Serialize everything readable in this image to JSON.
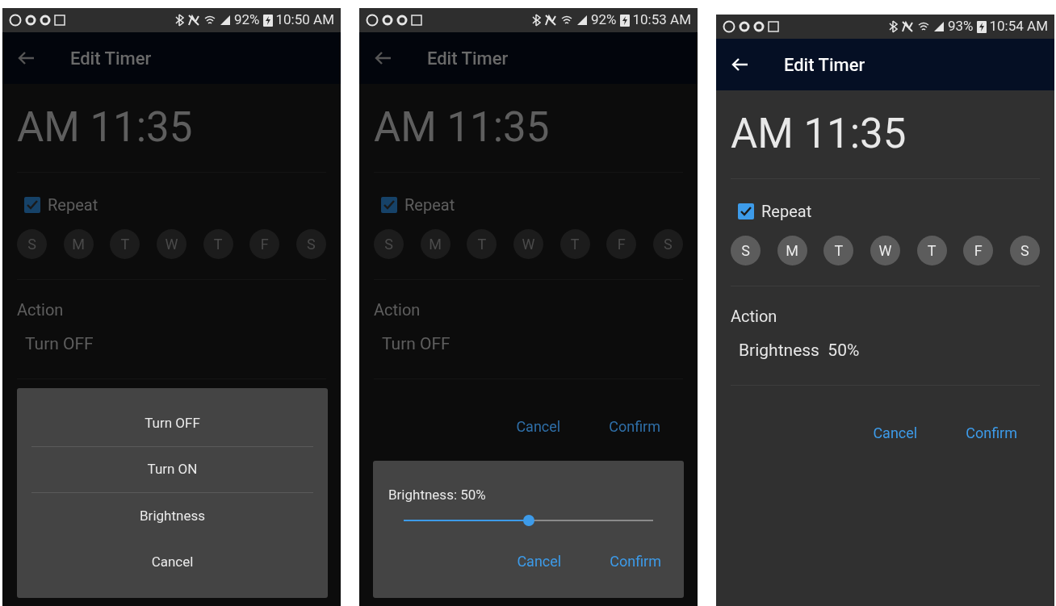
{
  "phones": [
    {
      "status_bar": {
        "battery": "92%",
        "time": "10:50 AM"
      },
      "app_bar": {
        "title": "Edit Timer"
      },
      "dimmed": true,
      "time": "AM 11:35",
      "repeat": {
        "label": "Repeat",
        "checked": true
      },
      "days": [
        {
          "label": "S"
        },
        {
          "label": "M"
        },
        {
          "label": "T"
        },
        {
          "label": "W"
        },
        {
          "label": "T"
        },
        {
          "label": "F"
        },
        {
          "label": "S"
        }
      ],
      "action": {
        "label": "Action",
        "value": "Turn OFF"
      },
      "dialog": {
        "kind": "menu",
        "items": [
          {
            "label": "Turn OFF"
          },
          {
            "label": "Turn ON"
          },
          {
            "label": "Brightness"
          },
          {
            "label": "Cancel"
          }
        ]
      }
    },
    {
      "status_bar": {
        "battery": "92%",
        "time": "10:53 AM"
      },
      "app_bar": {
        "title": "Edit Timer"
      },
      "dimmed": true,
      "time": "AM 11:35",
      "repeat": {
        "label": "Repeat",
        "checked": true
      },
      "days": [
        {
          "label": "S"
        },
        {
          "label": "M"
        },
        {
          "label": "T"
        },
        {
          "label": "W"
        },
        {
          "label": "T"
        },
        {
          "label": "F"
        },
        {
          "label": "S"
        }
      ],
      "action": {
        "label": "Action",
        "value": "Turn OFF"
      },
      "buttons": [
        "Cancel",
        "Confirm"
      ],
      "dialog": {
        "kind": "slider",
        "label": "Brightness: 50%",
        "level": 0.5,
        "buttons": [
          "Cancel",
          "Confirm"
        ]
      }
    },
    {
      "status_bar": {
        "battery": "93%",
        "time": "10:54 AM"
      },
      "app_bar": {
        "title": "Edit Timer"
      },
      "dimmed": false,
      "time": "AM 11:35",
      "repeat": {
        "label": "Repeat",
        "checked": true
      },
      "days": [
        {
          "label": "S"
        },
        {
          "label": "M"
        },
        {
          "label": "T"
        },
        {
          "label": "W"
        },
        {
          "label": "T"
        },
        {
          "label": "F"
        },
        {
          "label": "S"
        }
      ],
      "action": {
        "label": "Action",
        "value": "Brightness  50%"
      },
      "buttons": [
        "Cancel",
        "Confirm"
      ]
    }
  ]
}
